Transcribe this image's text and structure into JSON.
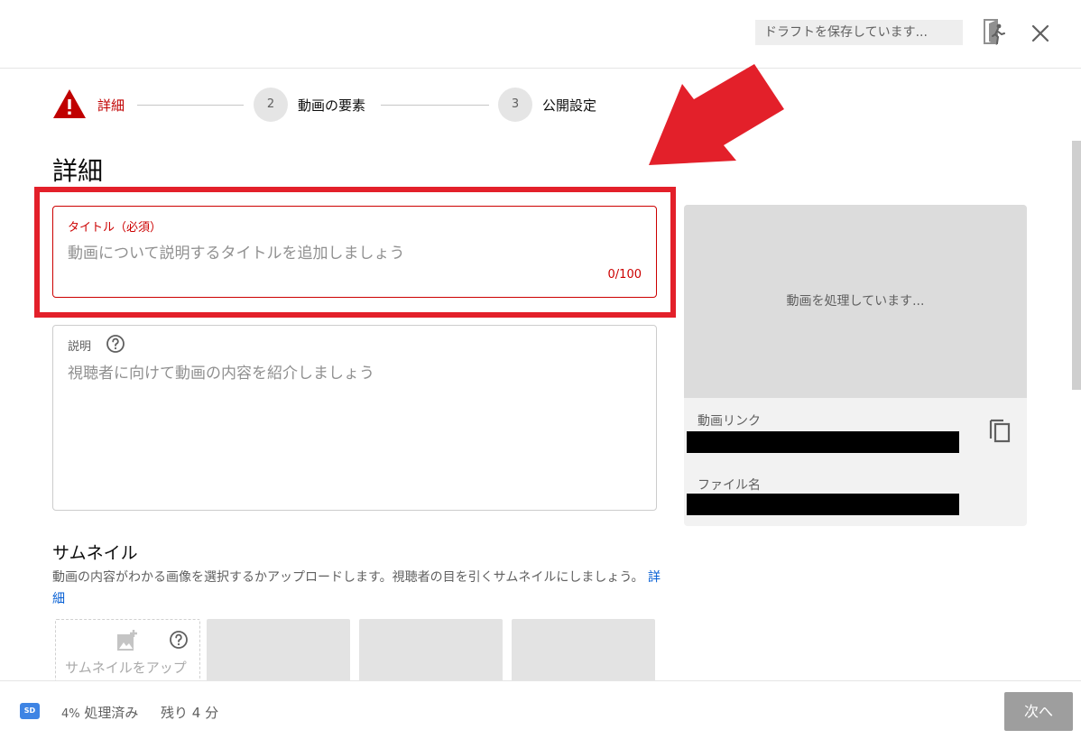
{
  "header": {
    "draft_status": "ドラフトを保存しています...",
    "feedback_icon": "feedback-exit-icon",
    "close_icon": "close-icon"
  },
  "stepper": {
    "steps": [
      {
        "number": "",
        "label": "詳細",
        "state": "error"
      },
      {
        "number": "2",
        "label": "動画の要素",
        "state": "pending"
      },
      {
        "number": "3",
        "label": "公開設定",
        "state": "pending"
      }
    ]
  },
  "page": {
    "title": "詳細"
  },
  "title_field": {
    "label": "タイトル（必須）",
    "placeholder": "動画について説明するタイトルを追加しましょう",
    "value": "",
    "counter": "0/100"
  },
  "description_field": {
    "label": "説明",
    "placeholder": "視聴者に向けて動画の内容を紹介しましょう",
    "value": ""
  },
  "thumbnail": {
    "title": "サムネイル",
    "description": "動画の内容がわかる画像を選択するかアップロードします。視聴者の目を引くサムネイルにしましょう。",
    "link": "詳細",
    "upload_label": "サムネイルをアップ"
  },
  "preview": {
    "processing_text": "動画を処理しています...",
    "link_label": "動画リンク",
    "link_value": "",
    "file_label": "ファイル名",
    "file_value": ""
  },
  "footer": {
    "badge": "SD",
    "progress_percent": "4%",
    "progress_label": "処理済み",
    "remaining": "残り 4 分",
    "next_button": "次へ"
  },
  "colors": {
    "error_red": "#cc0000",
    "annotation_red": "#e3202a",
    "link_blue": "#065fd4",
    "badge_blue": "#3e84e4",
    "disabled_button": "#9e9e9e"
  }
}
